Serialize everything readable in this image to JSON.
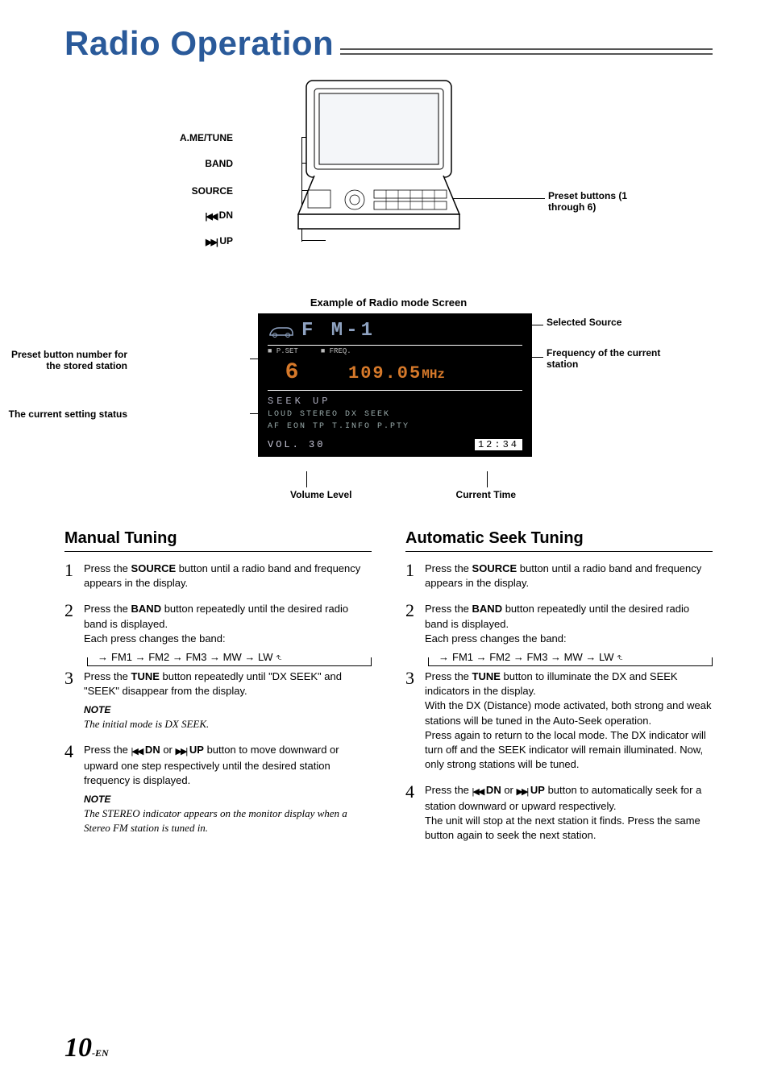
{
  "title": "Radio Operation",
  "device_labels": {
    "ame_tune": "A.ME/TUNE",
    "band": "BAND",
    "source": "SOURCE",
    "dn": "DN",
    "up": "UP",
    "preset_right": "Preset buttons (1 through 6)"
  },
  "screen_caption": "Example of Radio mode Screen",
  "screen": {
    "source": "F M-1",
    "pset_label": "P.SET",
    "freq_label": "FREQ.",
    "pset_num": "6",
    "freq_value": "109.05",
    "freq_unit": "MHz",
    "seek": "SEEK  UP",
    "status1": "LOUD  STEREO   DX  SEEK",
    "status2": "AF   EON  TP  T.INFO   P.PTY",
    "vol_label": "VOL. 30",
    "time": "12:34"
  },
  "screen_callouts": {
    "preset_num": "Preset button number for the stored station",
    "status": "The current setting status",
    "selected_source": "Selected Source",
    "freq": "Frequency of the current station",
    "volume": "Volume Level",
    "time": "Current Time"
  },
  "manual": {
    "heading": "Manual Tuning",
    "s1": "Press the SOURCE button until a radio band and frequency appears in the display.",
    "s2": "Press the BAND button repeatedly until the desired radio band is displayed.\nEach press changes the band:",
    "cycle": "FM1 → FM2 → FM3 → MW → LW",
    "s3": "Press the TUNE button repeatedly until \"DX SEEK\" and \"SEEK\" disappear from the display.",
    "s3_note_label": "NOTE",
    "s3_note": "The initial mode is DX SEEK.",
    "s4a": "Press the ",
    "s4_dn": " DN",
    "s4_or": " or ",
    "s4_up": " UP",
    "s4b": " button to move downward or upward one step respectively until the desired station frequency is displayed.",
    "s4_note_label": "NOTE",
    "s4_note": "The STEREO indicator appears on the monitor display when a Stereo FM station is tuned in."
  },
  "auto": {
    "heading": "Automatic Seek Tuning",
    "s1": "Press the SOURCE button until a radio band and frequency appears in the display.",
    "s2": "Press the BAND button repeatedly until the desired radio band is displayed.\nEach press changes the band:",
    "cycle": "FM1 → FM2 → FM3 → MW → LW",
    "s3": "Press the TUNE button to illuminate the DX and SEEK indicators in the display.\nWith the DX (Distance) mode activated, both strong and weak stations will be tuned in the Auto-Seek operation.\nPress again to return to the local mode. The DX indicator will turn off and the SEEK indicator will remain illuminated. Now, only strong stations will be tuned.",
    "s4a": "Press the ",
    "s4_dn": " DN",
    "s4_or": " or ",
    "s4_up": " UP",
    "s4b": " button to automatically seek for  a station downward or upward respectively.\nThe unit will stop at the next station it finds. Press the same button again to seek the next station."
  },
  "page": {
    "num": "10",
    "suffix": "-EN"
  }
}
